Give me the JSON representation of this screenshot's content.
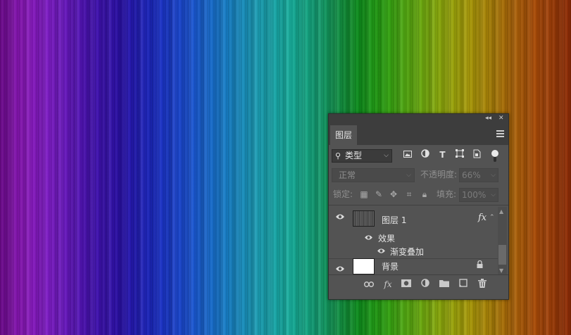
{
  "panel": {
    "tab_label": "图层",
    "filter_kind": "类型",
    "blend_mode": "正常",
    "opacity_label": "不透明度:",
    "opacity_value": "66%",
    "lock_label": "锁定:",
    "fill_label": "填充:",
    "fill_value": "100%"
  },
  "layers": [
    {
      "name": "图层 1",
      "fx": "fx",
      "visible": true
    },
    {
      "name": "效果",
      "visible": true
    },
    {
      "name": "渐变叠加",
      "visible": true
    },
    {
      "name": "背景",
      "visible": true,
      "locked": true
    }
  ],
  "colors": {
    "panel_bg": "#535353",
    "panel_header": "#3d3d3d",
    "text": "#e6e6e6",
    "disabled_text": "#8f8f8f"
  },
  "icons": {
    "filter_icons": [
      "image-filter-icon",
      "adjustment-filter-icon",
      "type-filter-icon",
      "shape-filter-icon",
      "smart-object-filter-icon"
    ],
    "bottom_icons": [
      "link-icon",
      "fx-icon",
      "mask-icon",
      "adjustment-layer-icon",
      "folder-icon",
      "new-layer-icon",
      "trash-icon"
    ]
  }
}
